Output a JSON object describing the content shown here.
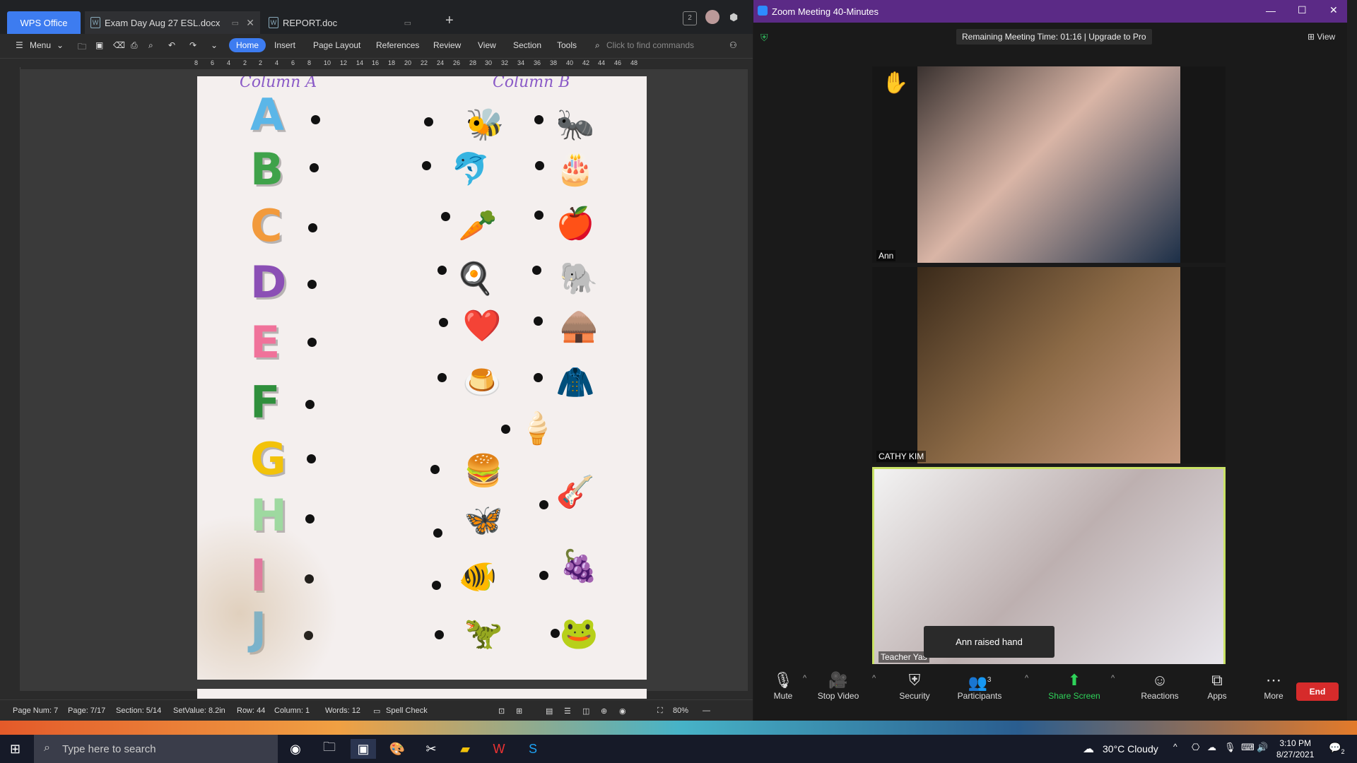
{
  "wps": {
    "brand": "WPS Office",
    "tabs": [
      {
        "label": "Exam Day Aug 27 ESL.docx",
        "icon": "word-doc-icon"
      },
      {
        "label": "REPORT.doc",
        "icon": "word-doc-icon"
      }
    ],
    "ribbon": {
      "menu": "Menu",
      "items": [
        "Home",
        "Insert",
        "Page Layout",
        "References",
        "Review",
        "View",
        "Section",
        "Tools"
      ],
      "search_placeholder": "Click to find commands"
    },
    "ruler_marks": [
      "8",
      "6",
      "4",
      "2",
      "2",
      "4",
      "6",
      "8",
      "10",
      "12",
      "14",
      "16",
      "18",
      "20",
      "22",
      "24",
      "26",
      "28",
      "30",
      "32",
      "34",
      "36",
      "38",
      "40",
      "42",
      "44",
      "46",
      "48"
    ],
    "document": {
      "column_a_title": "Column A",
      "column_b_title": "Column B",
      "letters": [
        "A",
        "B",
        "C",
        "D",
        "E",
        "F",
        "G",
        "H",
        "I",
        "J"
      ]
    },
    "status": {
      "page_num": "Page Num: 7",
      "page": "Page: 7/17",
      "section": "Section: 5/14",
      "setvalue": "SetValue: 8.2in",
      "row": "Row: 44",
      "column": "Column: 1",
      "words": "Words: 12",
      "spell_check": "Spell Check",
      "zoom": "80%"
    }
  },
  "zoom": {
    "title": "Zoom Meeting 40-Minutes",
    "banner": "Remaining Meeting Time: 01:16 | Upgrade to Pro",
    "view_label": "View",
    "participants": [
      {
        "name": "Ann"
      },
      {
        "name": "CATHY KIM"
      },
      {
        "name": "Teacher Yas"
      }
    ],
    "raise_hand_tip": "Ann raised hand",
    "toolbar": {
      "mute": "Mute",
      "stop_video": "Stop Video",
      "security": "Security",
      "participants": "Participants",
      "participants_count": "3",
      "share_screen": "Share Screen",
      "reactions": "Reactions",
      "apps": "Apps",
      "more": "More",
      "end": "End"
    }
  },
  "taskbar": {
    "search_placeholder": "Type here to search",
    "weather": "30°C  Cloudy",
    "time": "3:10 PM",
    "date": "8/27/2021",
    "notification_count": "2"
  }
}
